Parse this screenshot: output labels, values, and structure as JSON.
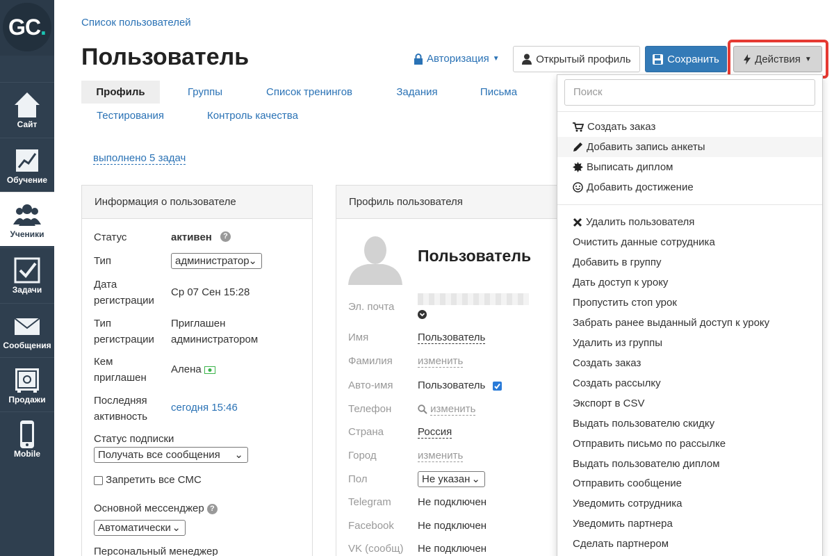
{
  "logo": {
    "text_g": "GC",
    "text_dot": "."
  },
  "sidebar": [
    {
      "label": "Сайт",
      "icon": "house-icon"
    },
    {
      "label": "Обучение",
      "icon": "chart-icon"
    },
    {
      "label": "Ученики",
      "icon": "users-icon"
    },
    {
      "label": "Задачи",
      "icon": "checkbox-icon"
    },
    {
      "label": "Сообщения",
      "icon": "envelope-icon"
    },
    {
      "label": "Продажи",
      "icon": "safe-icon"
    },
    {
      "label": "Mobile",
      "icon": "phone-icon"
    }
  ],
  "breadcrumb": "Список пользователей",
  "title": "Пользователь",
  "header": {
    "auth": "Авторизация",
    "open_profile": "Открытый профиль",
    "save": "Сохранить",
    "actions": "Действия"
  },
  "tabs": [
    "Профиль",
    "Группы",
    "Список тренингов",
    "Задания",
    "Письма",
    "Тестирования",
    "Контроль качества"
  ],
  "tasks_link": "выполнено 5 задач",
  "info_panel": {
    "title": "Информация о пользователе",
    "status_label": "Статус",
    "status_value": "активен",
    "type_label": "Тип",
    "type_value": "администратор",
    "reg_date_label_1": "Дата",
    "reg_date_label_2": "регистрации",
    "reg_date_value": "Ср 07 Сен 15:28",
    "reg_type_label_1": "Тип",
    "reg_type_label_2": "регистрации",
    "reg_type_value_1": "Приглашен",
    "reg_type_value_2": "администратором",
    "invited_label_1": "Кем",
    "invited_label_2": "приглашен",
    "invited_value": "Алена",
    "last_active_label_1": "Последняя",
    "last_active_label_2": "активность",
    "last_active_value": "сегодня 15:46",
    "sub_status_label": "Статус подписки",
    "sub_status_value": "Получать все сообщения",
    "forbid_sms": "Запретить все СМС",
    "messenger_label": "Основной мессенджер",
    "messenger_value": "Автоматически",
    "manager_label": "Персональный менеджер"
  },
  "profile_panel": {
    "title": "Профиль пользователя",
    "name_heading": "Пользователь",
    "email_label": "Эл. почта",
    "first_name_label": "Имя",
    "first_name_value": "Пользователь",
    "last_name_label": "Фамилия",
    "last_name_value": "изменить",
    "auto_name_label": "Авто-имя",
    "auto_name_value": "Пользователь",
    "phone_label": "Телефон",
    "phone_value": "изменить",
    "country_label": "Страна",
    "country_value": "Россия",
    "city_label": "Город",
    "city_value": "изменить",
    "gender_label": "Пол",
    "gender_value": "Не указан",
    "telegram_label": "Telegram",
    "telegram_value": "Не подключен",
    "facebook_label": "Facebook",
    "facebook_value": "Не подключен",
    "vk_label": "VK (сообщ)",
    "vk_value": "Не подключен"
  },
  "dropdown": {
    "search_placeholder": "Поиск",
    "group1": [
      {
        "label": "Создать заказ",
        "icon": "cart-icon"
      },
      {
        "label": "Добавить запись анкеты",
        "icon": "pencil-icon"
      },
      {
        "label": "Выписать диплом",
        "icon": "certificate-icon"
      },
      {
        "label": "Добавить достижение",
        "icon": "smile-icon"
      }
    ],
    "group2": [
      {
        "label": "Удалить пользователя",
        "icon": "x-icon"
      },
      {
        "label": "Очистить данные сотрудника"
      },
      {
        "label": "Добавить в группу"
      },
      {
        "label": "Дать доступ к уроку"
      },
      {
        "label": "Пропустить стоп урок"
      },
      {
        "label": "Забрать ранее выданный доступ к уроку"
      },
      {
        "label": "Удалить из группы"
      },
      {
        "label": "Создать заказ"
      },
      {
        "label": "Создать рассылку"
      },
      {
        "label": "Экспорт в CSV"
      },
      {
        "label": "Выдать пользователю скидку"
      },
      {
        "label": "Отправить письмо по рассылке"
      },
      {
        "label": "Выдать пользователю диплом"
      },
      {
        "label": "Отправить сообщение"
      },
      {
        "label": "Уведомить сотрудника"
      },
      {
        "label": "Уведомить партнера"
      },
      {
        "label": "Сделать партнером"
      }
    ]
  }
}
